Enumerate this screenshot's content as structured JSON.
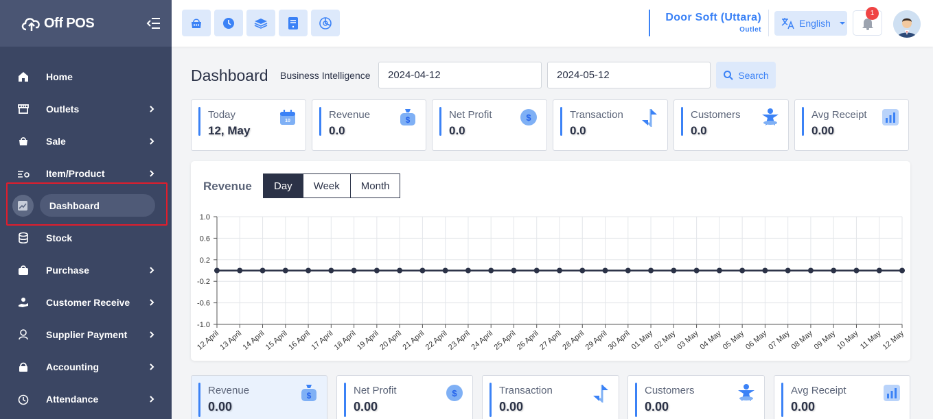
{
  "app": {
    "logo_text": "Off POS"
  },
  "sidebar": {
    "items": [
      {
        "label": "Home",
        "icon": "home-icon",
        "has_children": false
      },
      {
        "label": "Outlets",
        "icon": "store-icon",
        "has_children": true
      },
      {
        "label": "Sale",
        "icon": "basket-icon",
        "has_children": true
      },
      {
        "label": "Item/Product",
        "icon": "list-tag-icon",
        "has_children": true
      },
      {
        "label": "Dashboard",
        "icon": "chart-icon",
        "has_children": false,
        "active": true
      },
      {
        "label": "Stock",
        "icon": "database-icon",
        "has_children": false
      },
      {
        "label": "Purchase",
        "icon": "bag-icon",
        "has_children": true
      },
      {
        "label": "Customer Receive",
        "icon": "hand-coin-icon",
        "has_children": true
      },
      {
        "label": "Supplier Payment",
        "icon": "supplier-icon",
        "has_children": true
      },
      {
        "label": "Accounting",
        "icon": "lock-icon",
        "has_children": true
      },
      {
        "label": "Attendance",
        "icon": "clock-icon",
        "has_children": true
      }
    ]
  },
  "topbar": {
    "outlet_name": "Door Soft (Uttara)",
    "outlet_sub": "Outlet",
    "language": "English",
    "notification_count": "1",
    "buttons": [
      "pos-basket-icon",
      "clock-icon",
      "layers-icon",
      "tablet-icon",
      "pie-chart-icon"
    ]
  },
  "main": {
    "title": "Dashboard",
    "bi_label": "Business Intelligence",
    "start_date": "2024-04-12",
    "end_date": "2024-05-12",
    "search_label": "Search"
  },
  "stats_top": [
    {
      "title": "Today",
      "value": "12, May",
      "icon": "calendar-icon"
    },
    {
      "title": "Revenue",
      "value": "0.0",
      "icon": "money-bag-icon"
    },
    {
      "title": "Net Profit",
      "value": "0.0",
      "icon": "dollar-coin-icon"
    },
    {
      "title": "Transaction",
      "value": "0.0",
      "icon": "transfer-arrows-icon"
    },
    {
      "title": "Customers",
      "value": "0.0",
      "icon": "person-icon"
    },
    {
      "title": "Avg Receipt",
      "value": "0.00",
      "icon": "bar-chart-icon"
    }
  ],
  "revenue_chart": {
    "title": "Revenue",
    "tabs": [
      "Day",
      "Week",
      "Month"
    ],
    "active_tab": "Day"
  },
  "chart_data": {
    "type": "line",
    "title": "Revenue",
    "x": [
      "12 April",
      "13 April",
      "14 April",
      "15 April",
      "16 April",
      "17 April",
      "18 April",
      "19 April",
      "20 April",
      "21 April",
      "22 April",
      "23 April",
      "24 April",
      "25 April",
      "26 April",
      "27 April",
      "28 April",
      "29 April",
      "30 April",
      "01 May",
      "02 May",
      "03 May",
      "04 May",
      "05 May",
      "06 May",
      "07 May",
      "08 May",
      "09 May",
      "10 May",
      "11 May",
      "12 May"
    ],
    "series": [
      {
        "values": [
          0,
          0,
          0,
          0,
          0,
          0,
          0,
          0,
          0,
          0,
          0,
          0,
          0,
          0,
          0,
          0,
          0,
          0,
          0,
          0,
          0,
          0,
          0,
          0,
          0,
          0,
          0,
          0,
          0,
          0,
          0
        ]
      }
    ],
    "yticks": [
      "1.0",
      "0.6",
      "0.2",
      "-0.2",
      "-0.6",
      "-1.0"
    ],
    "ylim": [
      -1.0,
      1.0
    ],
    "grid": true,
    "color": "#2b3247"
  },
  "stats_bottom": [
    {
      "title": "Revenue",
      "value": "0.00",
      "icon": "money-bag-icon",
      "highlight": true
    },
    {
      "title": "Net Profit",
      "value": "0.00",
      "icon": "dollar-coin-icon"
    },
    {
      "title": "Transaction",
      "value": "0.00",
      "icon": "transfer-arrows-icon"
    },
    {
      "title": "Customers",
      "value": "0.00",
      "icon": "person-icon"
    },
    {
      "title": "Avg Receipt",
      "value": "0.00",
      "icon": "bar-chart-icon"
    }
  ]
}
